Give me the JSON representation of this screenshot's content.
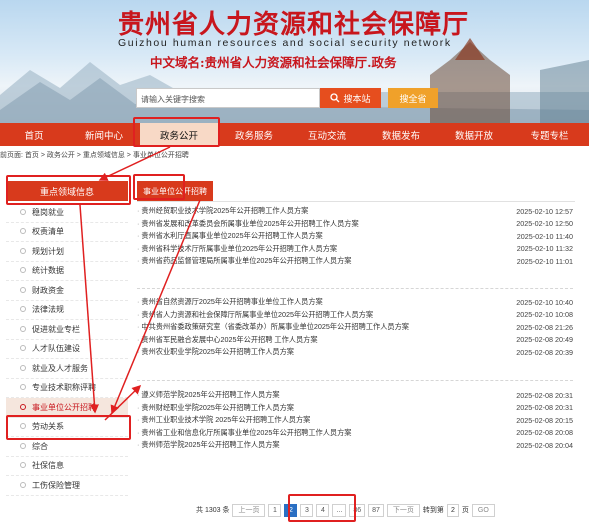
{
  "header": {
    "title": "贵州省人力资源和社会保障厅",
    "title_en": "Guizhou human resources and social security network",
    "domain": "中文域名:贵州省人力资源和社会保障厅.政务",
    "search_placeholder": "请输入关键字搜索",
    "search_button": "搜本站",
    "search_all_button": "搜全省"
  },
  "nav": {
    "items": [
      {
        "label": "首页"
      },
      {
        "label": "新闻中心"
      },
      {
        "label": "政务公开"
      },
      {
        "label": "政务服务"
      },
      {
        "label": "互动交流"
      },
      {
        "label": "数据发布"
      },
      {
        "label": "数据开放"
      },
      {
        "label": "专题专栏"
      }
    ],
    "active": "政务公开",
    "accent_color": "#d83a1c"
  },
  "breadcrumb": "前页面: 首页 > 政务公开 > 重点领域信息 > 事业单位公开招聘",
  "sidebar": {
    "heading": "重点领域信息",
    "items": [
      {
        "label": "稳岗就业"
      },
      {
        "label": "权责清单"
      },
      {
        "label": "规划计划"
      },
      {
        "label": "统计数据"
      },
      {
        "label": "财政资金"
      },
      {
        "label": "法律法规"
      },
      {
        "label": "促进就业专栏"
      },
      {
        "label": "人才队伍建设"
      },
      {
        "label": "就业及人才服务"
      },
      {
        "label": "专业技术职称评聘"
      },
      {
        "label": "事业单位公开招聘"
      },
      {
        "label": "劳动关系"
      },
      {
        "label": "综合"
      },
      {
        "label": "社保信息"
      },
      {
        "label": "工伤保险管理"
      }
    ],
    "active": "事业单位公开招聘"
  },
  "main": {
    "tab": "事业单位公开招聘",
    "group1": [
      {
        "title": "贵州经贸职业技术学院2025年公开招聘工作人员方案",
        "date": "2025-02-10 12:57"
      },
      {
        "title": "贵州省发展和改革委员会所属事业单位2025年公开招聘工作人员方案",
        "date": "2025-02-10 12:50"
      },
      {
        "title": "贵州省水利厅直属事业单位2025年公开招聘工作人员方案",
        "date": "2025-02-10 11:40"
      },
      {
        "title": "贵州省科学技术厅所属事业单位2025年公开招聘工作人员方案",
        "date": "2025-02-10 11:32"
      },
      {
        "title": "贵州省药品监督管理局所属事业单位2025年公开招聘工作人员方案",
        "date": "2025-02-10 11:01"
      }
    ],
    "group2": [
      {
        "title": "贵州省自然资源厅2025年公开招聘事业单位工作人员方案",
        "date": "2025-02-10 10:40"
      },
      {
        "title": "贵州省人力资源和社会保障厅所属事业单位2025年公开招聘工作人员方案",
        "date": "2025-02-10 10:08"
      },
      {
        "title": "中共贵州省委政策研究室（省委改革办）所属事业单位2025年公开招聘工作人员方案",
        "date": "2025-02-08 21:26"
      },
      {
        "title": "贵州省军民融合发展中心2025年公开招聘 工作人员方案",
        "date": "2025-02-08 20:49"
      },
      {
        "title": "贵州农业职业学院2025年公开招聘工作人员方案",
        "date": "2025-02-08 20:39"
      }
    ],
    "group3": [
      {
        "title": "遵义师范学院2025年公开招聘工作人员方案",
        "date": "2025-02-08 20:31"
      },
      {
        "title": "贵州财经职业学院2025年公开招聘工作人员方案",
        "date": "2025-02-08 20:31"
      },
      {
        "title": "贵州工业职业技术学院 2025年公开招聘工作人员方案",
        "date": "2025-02-08 20:15"
      },
      {
        "title": "贵州省工业和信息化厅所属事业单位2025年公开招聘工作人员方案",
        "date": "2025-02-08 20:08"
      },
      {
        "title": "贵州师范学院2025年公开招聘工作人员方案",
        "date": "2025-02-08 20:04"
      }
    ]
  },
  "pagination": {
    "total": "共 1303 条",
    "prev": "上一页",
    "pages": [
      "1",
      "2",
      "3",
      "4",
      "...",
      "86",
      "87"
    ],
    "current": "2",
    "next": "下一页",
    "goto_label": "转到第",
    "goto_value": "2",
    "goto_unit": "页",
    "go_button": "GO"
  }
}
